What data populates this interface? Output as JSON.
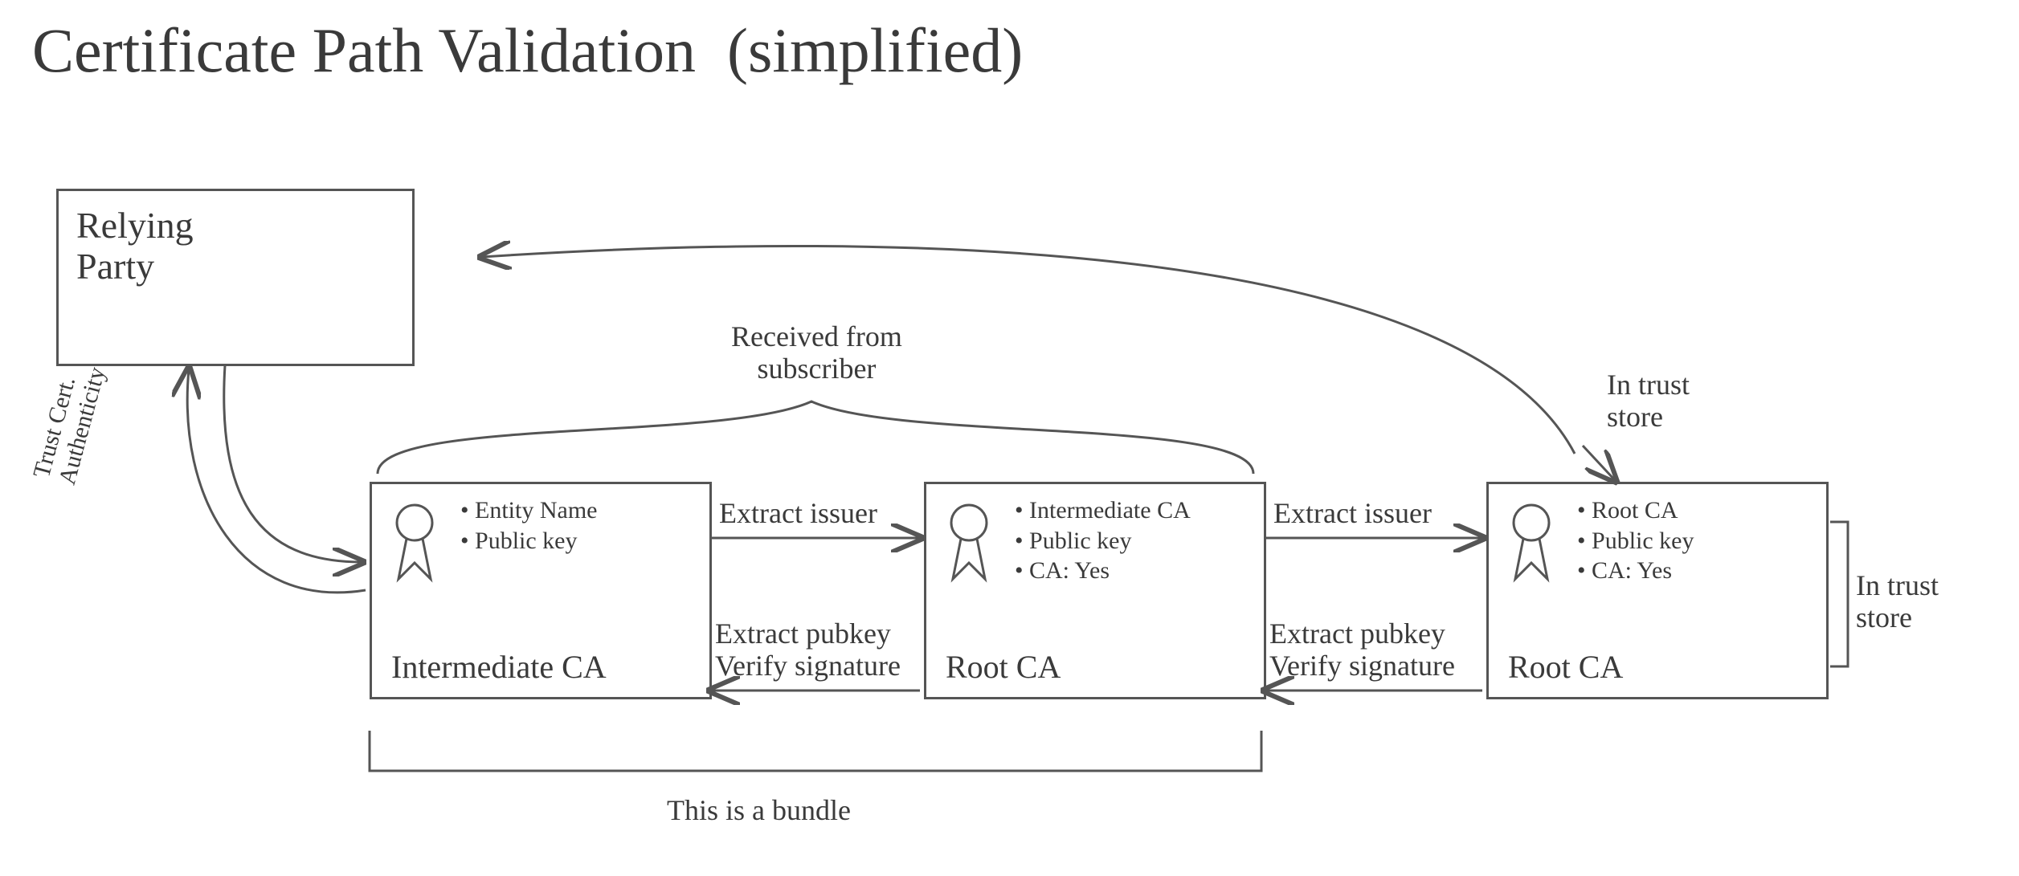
{
  "title": "Certificate Path Validation  (simplified)",
  "relying_party": {
    "label": "Relying\nParty"
  },
  "left_arrow": {
    "label": "Trust Cert.\nAuthenticity"
  },
  "received_label": "Received from\nsubscriber",
  "in_trust_store_top": "In trust\nstore",
  "in_trust_store_right": "In trust\nstore",
  "bundle_label": "This is a bundle",
  "arrows": {
    "a1_top": "Extract issuer",
    "a1_bot_1": "Extract pubkey",
    "a1_bot_2": "Verify signature",
    "a2_top": "Extract issuer",
    "a2_bot_1": "Extract pubkey",
    "a2_bot_2": "Verify signature"
  },
  "certs": [
    {
      "fields": [
        "• Entity Name",
        "• Public key"
      ],
      "issuer": "Intermediate CA"
    },
    {
      "fields": [
        "• Intermediate CA",
        "• Public key",
        "• CA: Yes"
      ],
      "issuer": "Root CA"
    },
    {
      "fields": [
        "• Root CA",
        "• Public key",
        "• CA: Yes"
      ],
      "issuer": "Root CA"
    }
  ]
}
